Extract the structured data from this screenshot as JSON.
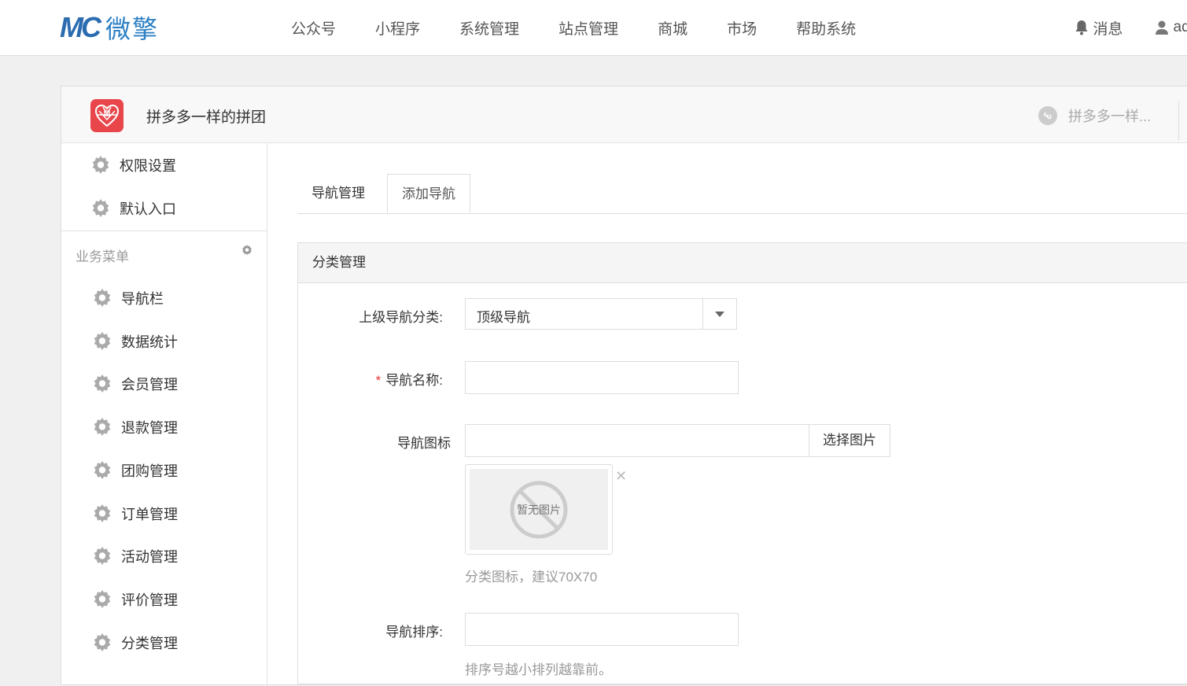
{
  "brand": {
    "mark": "MC",
    "name": "微擎"
  },
  "topnav": [
    "公众号",
    "小程序",
    "系统管理",
    "站点管理",
    "商城",
    "市场",
    "帮助系统"
  ],
  "topright": {
    "messages": "消息",
    "user": "adr"
  },
  "app": {
    "name": "拼多多一样的拼团",
    "switch_label": "拼多多一样..."
  },
  "sidebar": {
    "top_items": [
      "权限设置",
      "默认入口"
    ],
    "section_title": "业务菜单",
    "items": [
      "导航栏",
      "数据统计",
      "会员管理",
      "退款管理",
      "团购管理",
      "订单管理",
      "活动管理",
      "评价管理",
      "分类管理"
    ]
  },
  "tabs": [
    "导航管理",
    "添加导航"
  ],
  "form": {
    "card_title": "分类管理",
    "parent_label": "上级导航分类:",
    "parent_value": "顶级导航",
    "name_label": "导航名称:",
    "name_required": "*",
    "icon_label": "导航图标",
    "pick_button": "选择图片",
    "no_image": "暂无图片",
    "close_glyph": "✕",
    "icon_hint": "分类图标，建议70X70",
    "sort_label": "导航排序:",
    "sort_hint": "排序号越小排列越靠前。"
  },
  "colors": {
    "brand": "#2b7fc4",
    "app_icon": "#e8464b",
    "required": "#ee3333"
  }
}
